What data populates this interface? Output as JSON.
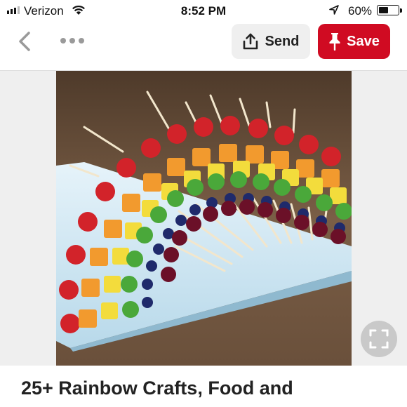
{
  "status_bar": {
    "carrier": "Verizon",
    "time": "8:52 PM",
    "battery": "60%",
    "battery_level": 0.6
  },
  "nav": {
    "send_label": "Send",
    "save_label": "Save",
    "send_color": "#efefef",
    "save_color": "#d00b22"
  },
  "pin": {
    "image_subject": "rainbow fruit skewers on a white platter",
    "title": "25+ Rainbow Crafts, Food and"
  },
  "icons": [
    "back-chevron-icon",
    "more-icon",
    "share-icon",
    "pin-icon",
    "expand-icon"
  ]
}
